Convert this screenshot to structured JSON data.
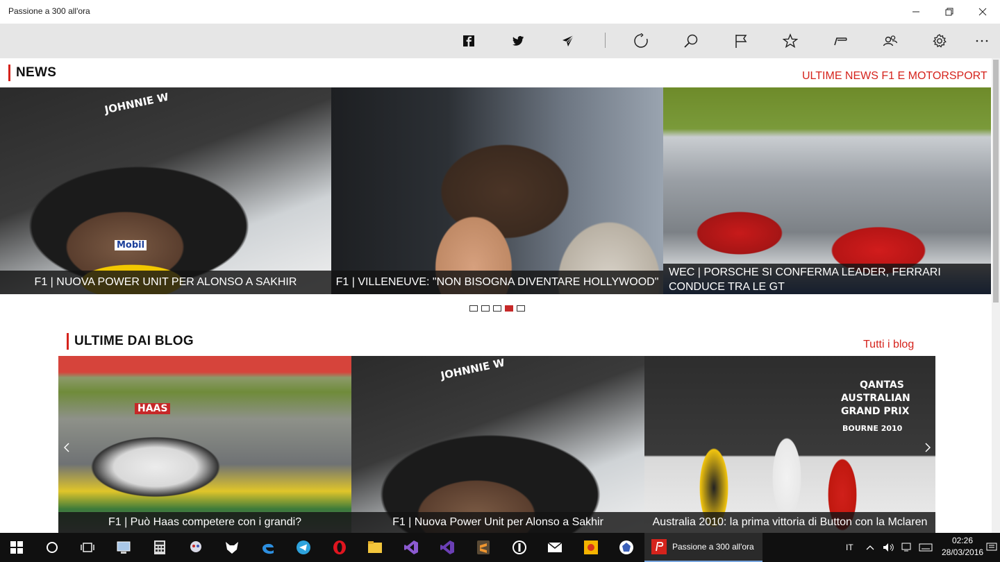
{
  "window": {
    "title": "Passione a 300 all'ora"
  },
  "toolbar": {
    "icons": [
      "facebook-icon",
      "twitter-icon",
      "telegram-icon",
      "refresh-icon",
      "search-icon",
      "flag-icon",
      "star-icon",
      "sections-icon",
      "people-icon",
      "settings-icon",
      "more-icon"
    ]
  },
  "news": {
    "title": "NEWS",
    "link": "ULTIME NEWS F1 E MOTORSPORT",
    "items": [
      {
        "caption": "F1 | NUOVA POWER UNIT PER ALONSO A SAKHIR",
        "image": "driver-helmet"
      },
      {
        "caption": "F1 | VILLENEUVE: \"NON BISOGNA DIVENTARE HOLLYWOOD\"",
        "image": "villeneuve-portrait"
      },
      {
        "caption": "WEC | PORSCHE SI CONFERMA LEADER, FERRARI CONDUCE TRA LE GT",
        "image": "ferrari-gt-cars"
      }
    ],
    "pager": {
      "count": 5,
      "active": 4
    }
  },
  "blogs": {
    "title": "ULTIME DAI BLOG",
    "link": "Tutti i blog",
    "items": [
      {
        "caption": "F1 | Può Haas competere con i grandi?",
        "image": "haas-car"
      },
      {
        "caption": "F1 | Nuova Power Unit per Alonso a Sakhir",
        "image": "driver-helmet"
      },
      {
        "caption": "Australia 2010: la prima vittoria di Button con la Mclaren",
        "image": "podium"
      }
    ],
    "image_texts": {
      "podium_sign_1": "QANTAS",
      "podium_sign_2": "AUSTRALIAN",
      "podium_sign_3": "GRAND PRIX",
      "podium_sign_4": "BOURNE 2010",
      "haas_car": "HAAS",
      "helmet_sponsor": "JOHNNIE W",
      "helmet_brand": "Mobil"
    }
  },
  "taskbar": {
    "active_app": "Passione a 300 all'ora",
    "language": "IT",
    "time": "02:26",
    "date": "28/03/2016"
  },
  "colors": {
    "accent": "#d5231c",
    "toolbar_bg": "#e6e6e6",
    "taskbar_bg": "#101010"
  }
}
